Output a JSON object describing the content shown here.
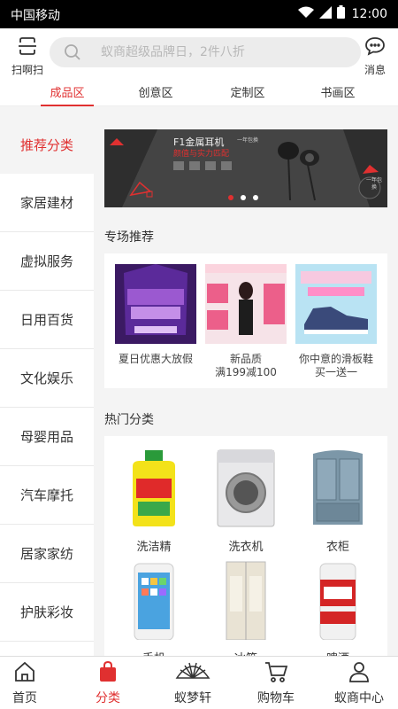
{
  "status": {
    "carrier": "中国移动",
    "time": "12:00"
  },
  "header": {
    "scan_label": "扫啊扫",
    "search_placeholder": "蚁商超级品牌日，2件八折",
    "message_label": "消息"
  },
  "tabs": [
    {
      "label": "成品区",
      "active": true
    },
    {
      "label": "创意区",
      "active": false
    },
    {
      "label": "定制区",
      "active": false
    },
    {
      "label": "书画区",
      "active": false
    }
  ],
  "sidebar": [
    {
      "label": "推荐分类",
      "active": true
    },
    {
      "label": "家居建材"
    },
    {
      "label": "虚拟服务"
    },
    {
      "label": "日用百货"
    },
    {
      "label": "文化娱乐"
    },
    {
      "label": "母婴用品"
    },
    {
      "label": "汽车摩托"
    },
    {
      "label": "居家家纺"
    },
    {
      "label": "护肤彩妆"
    }
  ],
  "banner": {
    "title": "F1金属耳机",
    "subtitle": "颜值与实力匹配",
    "tag": "一年包换",
    "badge": "一年包换",
    "slides": 3,
    "current_slide": 1
  },
  "special": {
    "title": "专场推荐",
    "items": [
      {
        "caption1": "夏日优惠大放假",
        "caption2": ""
      },
      {
        "caption1": "新品质",
        "caption2": "满199减100"
      },
      {
        "caption1": "你中意的滑板鞋",
        "caption2": "买一送一"
      }
    ]
  },
  "hot": {
    "title": "热门分类",
    "items": [
      {
        "label": "洗洁精",
        "icon": "detergent-bottle"
      },
      {
        "label": "洗衣机",
        "icon": "washing-machine"
      },
      {
        "label": "衣柜",
        "icon": "wardrobe"
      },
      {
        "label": "手机",
        "icon": "smartphone"
      },
      {
        "label": "冰箱",
        "icon": "refrigerator"
      },
      {
        "label": "啤酒",
        "icon": "beer-can"
      }
    ]
  },
  "bottom_nav": [
    {
      "label": "首页",
      "icon": "home-icon"
    },
    {
      "label": "分类",
      "icon": "bag-icon",
      "active": true
    },
    {
      "label": "蚁梦轩",
      "icon": "fan-icon"
    },
    {
      "label": "购物车",
      "icon": "cart-icon"
    },
    {
      "label": "蚁商中心",
      "icon": "user-icon"
    }
  ],
  "colors": {
    "accent": "#e03030"
  }
}
